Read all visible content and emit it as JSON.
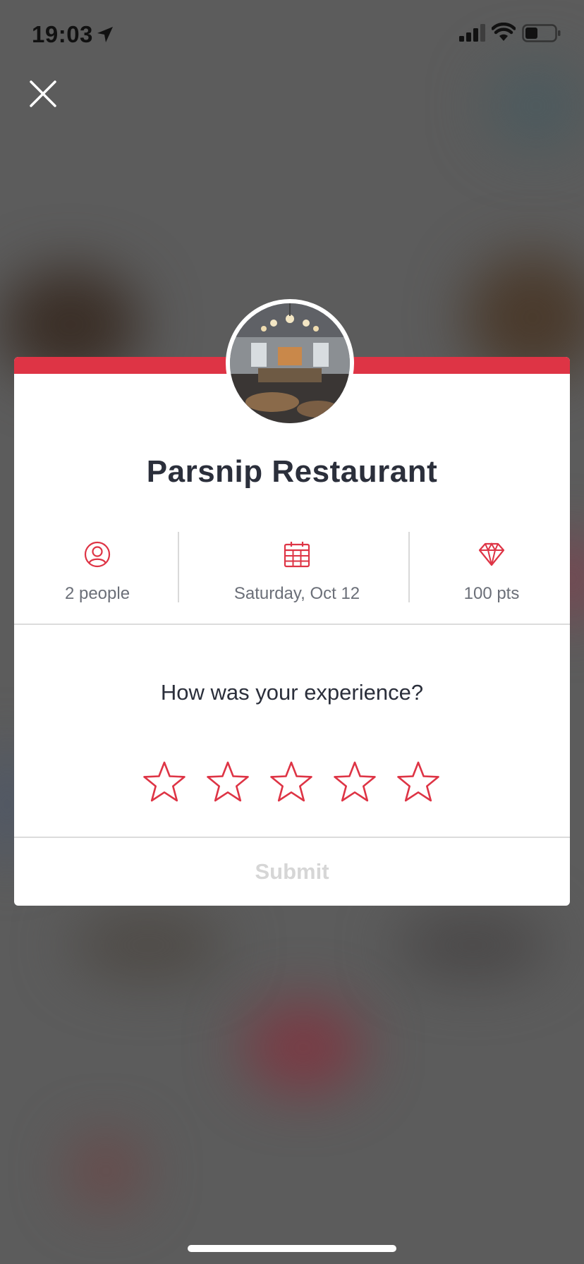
{
  "status_bar": {
    "time": "19:03"
  },
  "restaurant": {
    "name": "Parsnip Restaurant"
  },
  "details": {
    "party": "2 people",
    "date": "Saturday, Oct 12",
    "points": "100 pts"
  },
  "rating": {
    "question": "How was your experience?",
    "stars_total": 5,
    "stars_selected": 0
  },
  "actions": {
    "submit_label": "Submit"
  },
  "colors": {
    "accent": "#de3445",
    "title": "#2b2f3b",
    "submit_disabled": "#d6d6d6"
  },
  "icons": {
    "close": "close-icon",
    "people": "person-circle-icon",
    "date": "calendar-icon",
    "points": "diamond-icon",
    "star": "star-outline-icon"
  }
}
